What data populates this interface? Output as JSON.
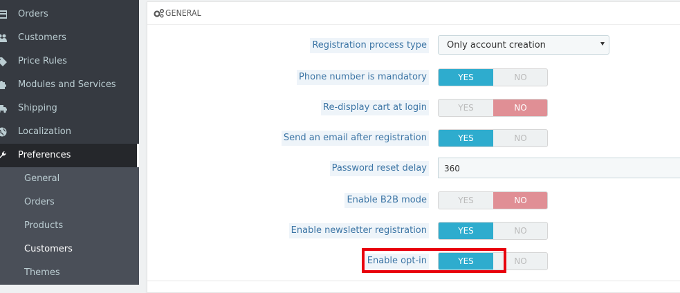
{
  "sidebar": {
    "items": [
      {
        "label": "Orders",
        "icon": "credit-card-icon"
      },
      {
        "label": "Customers",
        "icon": "users-icon"
      },
      {
        "label": "Price Rules",
        "icon": "tags-icon"
      },
      {
        "label": "Modules and Services",
        "icon": "puzzle-icon"
      },
      {
        "label": "Shipping",
        "icon": "truck-icon"
      },
      {
        "label": "Localization",
        "icon": "globe-icon"
      },
      {
        "label": "Preferences",
        "icon": "wrench-icon"
      }
    ],
    "active_item": "Preferences",
    "subitems": [
      {
        "label": "General"
      },
      {
        "label": "Orders"
      },
      {
        "label": "Products"
      },
      {
        "label": "Customers"
      },
      {
        "label": "Themes"
      }
    ],
    "current_subitem": "Customers"
  },
  "panel": {
    "title": "GENERAL",
    "title_icon": "cogs-icon"
  },
  "form": {
    "registration_process_type": {
      "label": "Registration process type",
      "value": "Only account creation"
    },
    "phone_mandatory": {
      "label": "Phone number is mandatory",
      "yes": "YES",
      "no": "NO",
      "selected": "YES"
    },
    "redisplay_cart": {
      "label": "Re-display cart at login",
      "yes": "YES",
      "no": "NO",
      "selected": "NO"
    },
    "send_email": {
      "label": "Send an email after registration",
      "yes": "YES",
      "no": "NO",
      "selected": "YES"
    },
    "password_reset_delay": {
      "label": "Password reset delay",
      "value": "360"
    },
    "b2b_mode": {
      "label": "Enable B2B mode",
      "yes": "YES",
      "no": "NO",
      "selected": "NO"
    },
    "newsletter": {
      "label": "Enable newsletter registration",
      "yes": "YES",
      "no": "NO",
      "selected": "YES"
    },
    "optin": {
      "label": "Enable opt-in",
      "yes": "YES",
      "no": "NO",
      "selected": "YES"
    }
  },
  "colors": {
    "sidebar_bg": "#363a41",
    "yes_active": "#2eacce",
    "no_active": "#e08f95",
    "highlight": "#e8000d",
    "label_text": "#3c75a5"
  }
}
